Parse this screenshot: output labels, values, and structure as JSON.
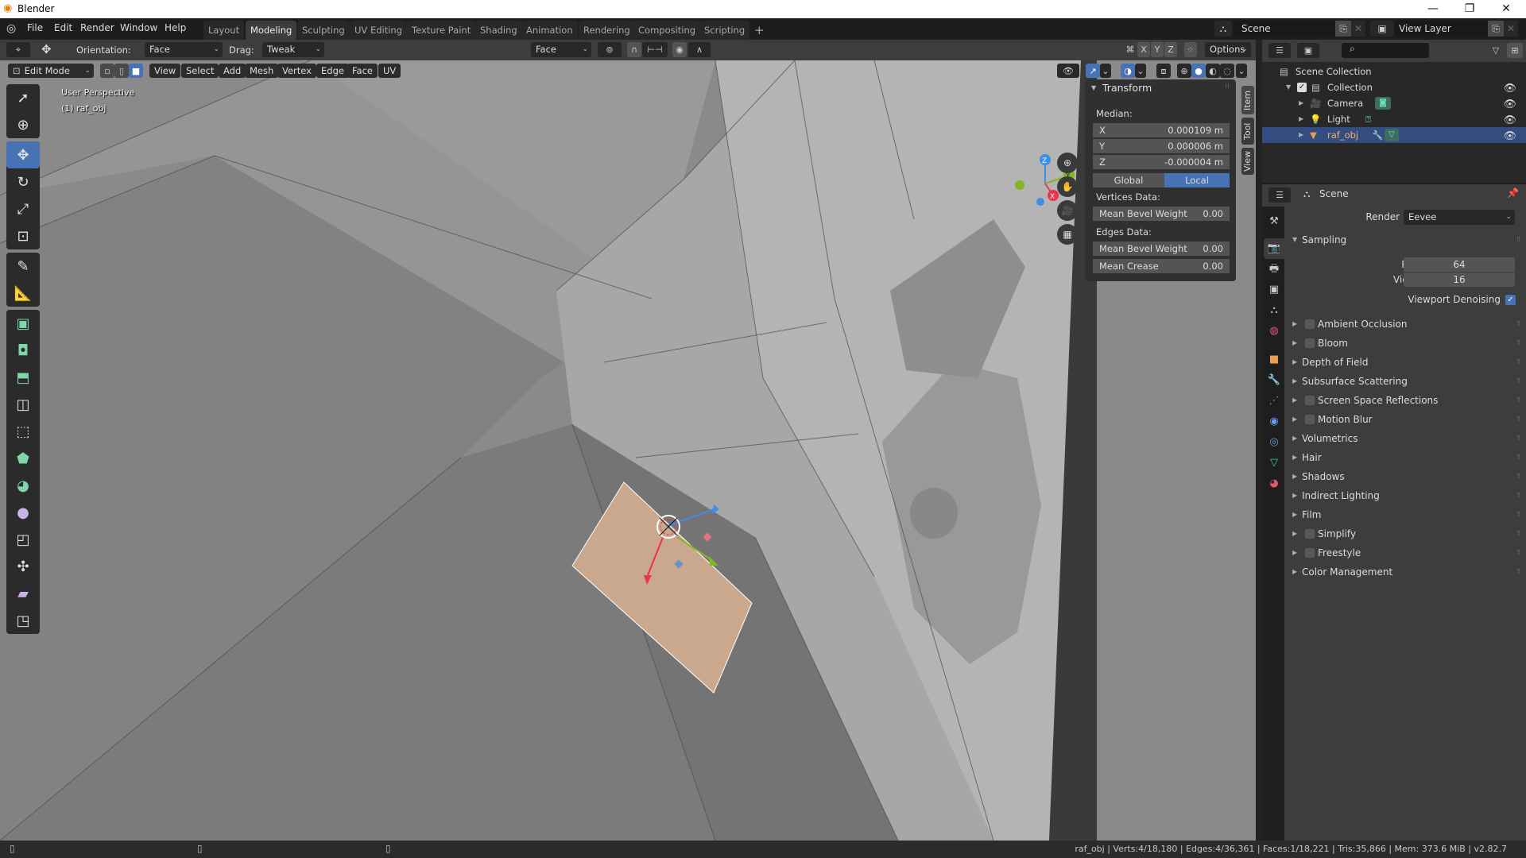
{
  "window": {
    "title": "Blender",
    "controls": {
      "minimize": "—",
      "maximize": "❐",
      "close": "✕"
    }
  },
  "menubar": {
    "items": [
      "File",
      "Edit",
      "Render",
      "Window",
      "Help"
    ],
    "workspaces": [
      "Layout",
      "Modeling",
      "Sculpting",
      "UV Editing",
      "Texture Paint",
      "Shading",
      "Animation",
      "Rendering",
      "Compositing",
      "Scripting"
    ],
    "active_workspace": "Modeling",
    "add_workspace": "+",
    "scene_name": "Scene",
    "view_layer_name": "View Layer"
  },
  "tool_header": {
    "orientation_label": "Orientation:",
    "orientation_value": "Face",
    "drag_label": "Drag:",
    "drag_value": "Tweak",
    "pivot_value": "Face",
    "axes": [
      "X",
      "Y",
      "Z"
    ],
    "options_label": "Options"
  },
  "viewport_header": {
    "mode": "Edit Mode",
    "menus": [
      "View",
      "Select",
      "Add",
      "Mesh",
      "Vertex",
      "Edge",
      "Face",
      "UV"
    ]
  },
  "viewport": {
    "perspective_label": "User Perspective",
    "object_label": "(1) raf_obj",
    "gizmo_axes": {
      "x": "X",
      "y": "Y",
      "z": "Z"
    },
    "colors": {
      "x_axis": "#e8344e",
      "y_axis": "#84b525",
      "z_axis": "#3d8ee8",
      "selected_face": "#c9a88d"
    }
  },
  "toolbar": {
    "tools": [
      "select-box",
      "cursor",
      "move",
      "rotate",
      "scale",
      "transform",
      "annotate",
      "measure",
      "extrude-region",
      "inset-faces",
      "bevel",
      "loop-cut",
      "knife",
      "poly-build",
      "spin",
      "smooth",
      "edge-slide",
      "shrink-fatten",
      "shear",
      "rip-region"
    ],
    "active": "move"
  },
  "npanel": {
    "title": "Transform",
    "median_label": "Median:",
    "x_label": "X",
    "x_value": "0.000109 m",
    "y_label": "Y",
    "y_value": "0.000006 m",
    "z_label": "Z",
    "z_value": "-0.000004 m",
    "global_label": "Global",
    "local_label": "Local",
    "vertices_label": "Vertices Data:",
    "v_bevel_label": "Mean Bevel Weight",
    "v_bevel_value": "0.00",
    "edges_label": "Edges Data:",
    "e_bevel_label": "Mean Bevel Weight",
    "e_bevel_value": "0.00",
    "crease_label": "Mean Crease",
    "crease_value": "0.00",
    "tabs": [
      "Item",
      "Tool",
      "View"
    ]
  },
  "outliner": {
    "search_placeholder": "",
    "root": "Scene Collection",
    "collection": "Collection",
    "items": [
      {
        "name": "Camera"
      },
      {
        "name": "Light"
      },
      {
        "name": "raf_obj",
        "selected": true
      }
    ]
  },
  "properties": {
    "context": "Scene",
    "render_engine_label": "Render Engine",
    "render_engine_value": "Eevee",
    "sampling_label": "Sampling",
    "render_label": "Render",
    "render_value": "64",
    "viewport_label": "Viewport",
    "viewport_value": "16",
    "denoise_label": "Viewport Denoising",
    "denoise_checked": true,
    "sections": [
      {
        "label": "Ambient Occlusion",
        "checkbox": true
      },
      {
        "label": "Bloom",
        "checkbox": true
      },
      {
        "label": "Depth of Field",
        "checkbox": false
      },
      {
        "label": "Subsurface Scattering",
        "checkbox": false
      },
      {
        "label": "Screen Space Reflections",
        "checkbox": true
      },
      {
        "label": "Motion Blur",
        "checkbox": true
      },
      {
        "label": "Volumetrics",
        "checkbox": false
      },
      {
        "label": "Hair",
        "checkbox": false
      },
      {
        "label": "Shadows",
        "checkbox": false
      },
      {
        "label": "Indirect Lighting",
        "checkbox": false
      },
      {
        "label": "Film",
        "checkbox": false
      },
      {
        "label": "Simplify",
        "checkbox": true
      },
      {
        "label": "Freestyle",
        "checkbox": true
      },
      {
        "label": "Color Management",
        "checkbox": false
      }
    ]
  },
  "statusbar": {
    "stats": "raf_obj | Verts:4/18,180 | Edges:4/36,361 | Faces:1/18,221 | Tris:35,866 | Mem: 373.6 MiB | v2.82.7"
  }
}
